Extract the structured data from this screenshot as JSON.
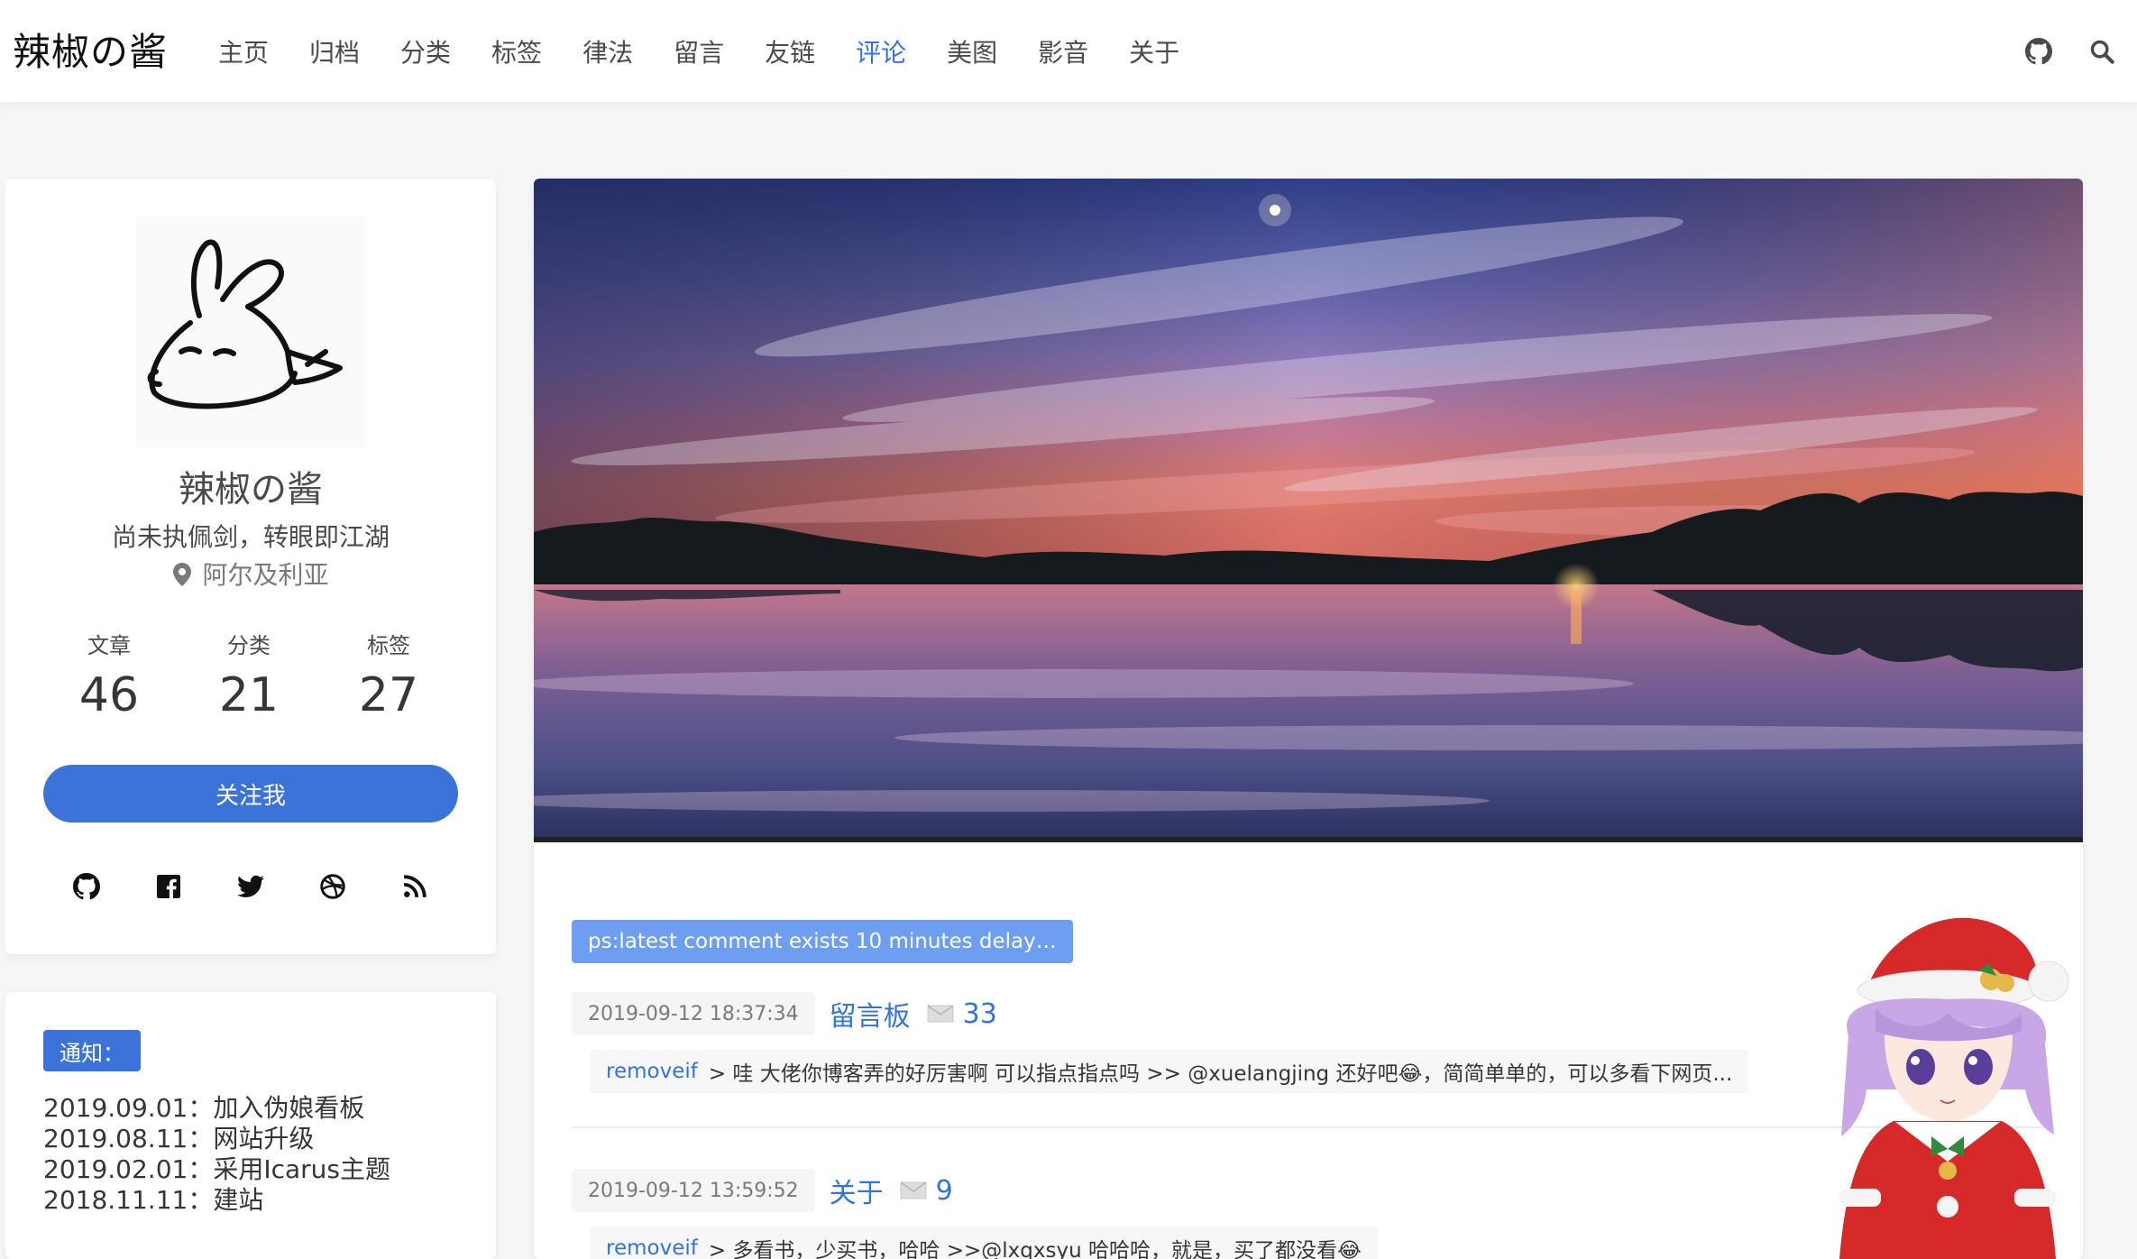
{
  "brand": "辣椒の酱",
  "nav": {
    "items": [
      {
        "label": "主页",
        "active": false
      },
      {
        "label": "归档",
        "active": false
      },
      {
        "label": "分类",
        "active": false
      },
      {
        "label": "标签",
        "active": false
      },
      {
        "label": "律法",
        "active": false
      },
      {
        "label": "留言",
        "active": false
      },
      {
        "label": "友链",
        "active": false
      },
      {
        "label": "评论",
        "active": true
      },
      {
        "label": "美图",
        "active": false
      },
      {
        "label": "影音",
        "active": false
      },
      {
        "label": "关于",
        "active": false
      }
    ],
    "icons": [
      "github-icon",
      "search-icon"
    ]
  },
  "profile": {
    "name": "辣椒の酱",
    "motto": "尚未执佩剑，转眼即江湖",
    "location": "阿尔及利亚",
    "stats": [
      {
        "label": "文章",
        "value": "46"
      },
      {
        "label": "分类",
        "value": "21"
      },
      {
        "label": "标签",
        "value": "27"
      }
    ],
    "follow_label": "关注我",
    "socials": [
      "github-icon",
      "facebook-icon",
      "twitter-icon",
      "dribbble-icon",
      "rss-icon"
    ]
  },
  "notice": {
    "tag": "通知：",
    "items": [
      "2019.09.01：加入伪娘看板",
      "2019.08.11：网站升级",
      "2019.02.01：采用Icarus主题",
      "2018.11.11：建站"
    ]
  },
  "comments": {
    "hint": "ps:latest comment exists 10 minutes delay…",
    "list": [
      {
        "time": "2019-09-12 18:37:34",
        "title": "留言板",
        "count": "33",
        "user": "removeif",
        "text": "> 哇 大佬你博客弄的好厉害啊 可以指点指点吗 >> @xuelangjing 还好吧😂，简简单单的，可以多看下网页..."
      },
      {
        "time": "2019-09-12 13:59:52",
        "title": "关于",
        "count": "9",
        "user": "removeif",
        "text": "> 多看书，少买书，哈哈 >>@lxqxsyu 哈哈哈，就是，买了都没看😂"
      }
    ]
  },
  "colors": {
    "accent": "#3273dc",
    "button": "#3b73d8",
    "hint": "#6d9ef0"
  }
}
